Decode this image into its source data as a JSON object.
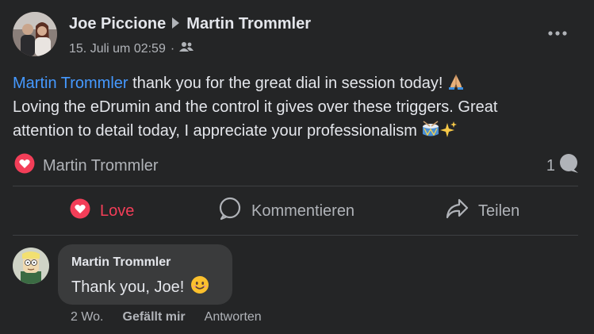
{
  "post": {
    "author": "Joe Piccione",
    "target": "Martin Trommler",
    "timestamp": "15. Juli um 02:59",
    "audience_icon": "friends-icon",
    "mention": "Martin Trommler",
    "text_line1": " thank you for the great dial in session today! ",
    "text_line2": "Loving the eDrumin and the control it gives over these triggers.  Great",
    "text_line3": "attention to detail today, I appreciate your professionalism ",
    "emojis": [
      "folded-hands-emoji",
      "drum-emoji",
      "sparkles-emoji"
    ]
  },
  "reactions": {
    "type": "love",
    "by": "Martin Trommler",
    "comment_count": "1"
  },
  "actions": {
    "love_label": "Love",
    "comment_label": "Kommentieren",
    "share_label": "Teilen"
  },
  "comment": {
    "author": "Martin Trommler",
    "text": "Thank you, Joe!",
    "time": "2 Wo.",
    "like_label": "Gefällt mir",
    "reply_label": "Antworten"
  },
  "colors": {
    "background": "#242526",
    "text": "#e4e6eb",
    "muted": "#b0b3b8",
    "mention": "#4599ff",
    "love": "#f33e58",
    "bubble": "#3a3b3c"
  }
}
